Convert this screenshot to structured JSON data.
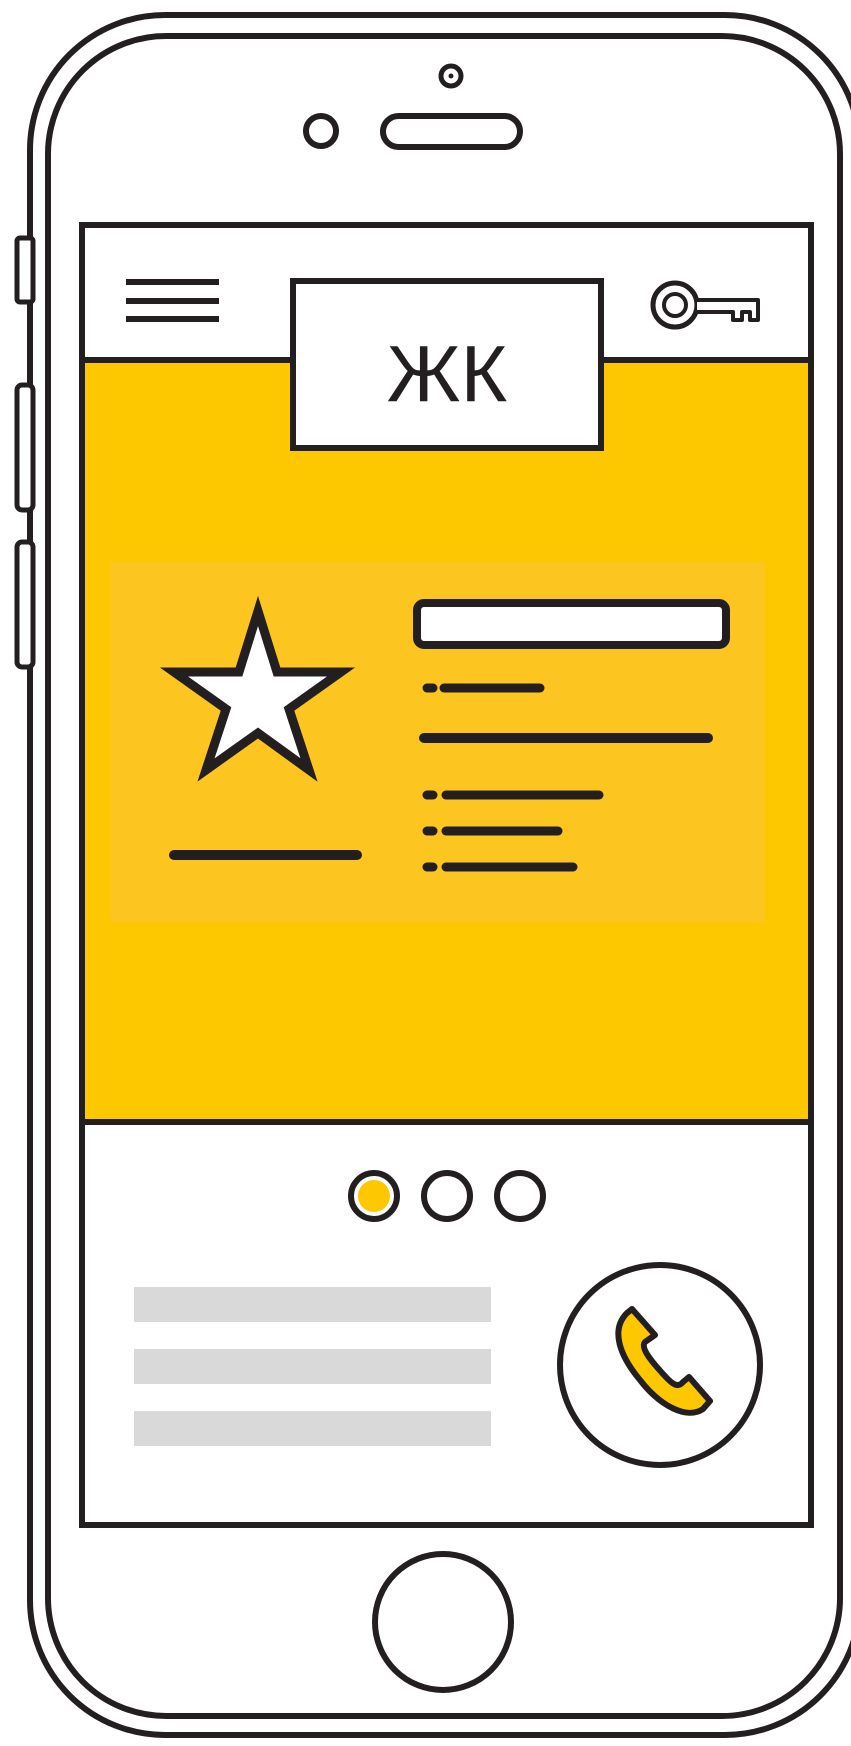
{
  "header": {
    "logo_text": "ЖК",
    "menu_icon": "hamburger-menu-icon",
    "key_icon": "key-icon"
  },
  "hero": {
    "background_color": "#fdc800",
    "card_color": "#fcc520",
    "featured_icon": "star-icon"
  },
  "carousel": {
    "total_slides": 3,
    "active_slide": 1,
    "active_color": "#fdc800"
  },
  "footer": {
    "phone_icon": "phone-icon",
    "phone_icon_color": "#fdc800",
    "placeholder_color": "#d9d9d9"
  },
  "colors": {
    "outline": "#231f20",
    "screen": "#ffffff"
  }
}
